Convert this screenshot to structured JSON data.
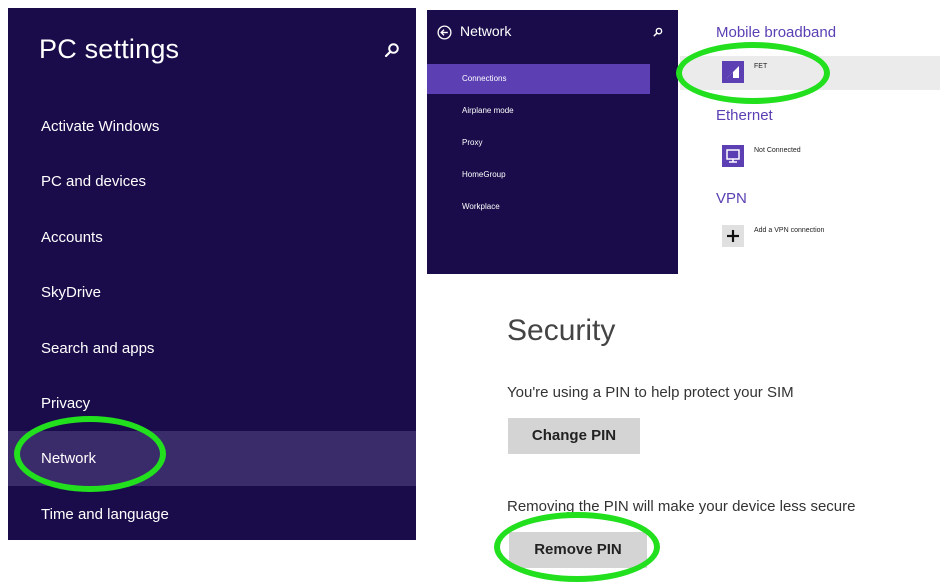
{
  "pc_settings": {
    "title": "PC settings",
    "search_icon": "search-icon",
    "items": [
      {
        "label": "Activate Windows"
      },
      {
        "label": "PC and devices"
      },
      {
        "label": "Accounts"
      },
      {
        "label": "SkyDrive"
      },
      {
        "label": "Search and apps"
      },
      {
        "label": "Privacy"
      },
      {
        "label": "Network",
        "selected": true
      },
      {
        "label": "Time and language"
      }
    ]
  },
  "network": {
    "title": "Network",
    "back_icon": "back-arrow-icon",
    "search_icon": "search-icon",
    "items": [
      {
        "label": "Connections",
        "selected": true
      },
      {
        "label": "Airplane mode"
      },
      {
        "label": "Proxy"
      },
      {
        "label": "HomeGroup"
      },
      {
        "label": "Workplace"
      }
    ]
  },
  "connections": {
    "mobile_broadband": {
      "heading": "Mobile broadband",
      "label": "FET",
      "icon": "signal-icon"
    },
    "ethernet": {
      "heading": "Ethernet",
      "label": "Not Connected",
      "icon": "monitor-icon"
    },
    "vpn": {
      "heading": "VPN",
      "label": "Add a VPN connection",
      "icon": "plus-icon"
    }
  },
  "security": {
    "title": "Security",
    "pin_text": "You're using a PIN to help protect your SIM",
    "change_pin_label": "Change PIN",
    "remove_text": "Removing the PIN will make your device less secure",
    "remove_pin_label": "Remove PIN"
  },
  "colors": {
    "panel_bg": "#1a0c4a",
    "accent": "#5b3fb3",
    "highlight_ring": "#22e01e"
  }
}
